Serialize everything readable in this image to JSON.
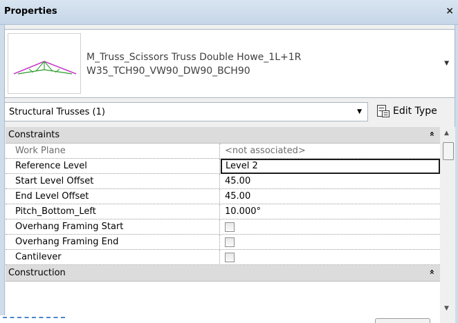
{
  "panel": {
    "title": "Properties",
    "close_glyph": "×"
  },
  "type_selector": {
    "name_line1": "M_Truss_Scissors Truss Double Howe_1L+1R",
    "name_line2": "W35_TCH90_VW90_DW90_BCH90",
    "thumbnail_icon": "truss-thumbnail-icon",
    "dropdown_glyph": "▼"
  },
  "instance_filter": {
    "label": "Structural Trusses (1)",
    "dropdown_glyph": "▼"
  },
  "edit_type": {
    "label": "Edit Type",
    "icon": "edit-type-icon"
  },
  "groups": {
    "constraints": {
      "label": "Constraints",
      "toggle_glyph": "»"
    },
    "construction": {
      "label": "Construction",
      "toggle_glyph": "»"
    }
  },
  "rows": [
    {
      "name": "Work Plane",
      "value": "<not associated>"
    },
    {
      "name": "Reference Level",
      "value": "Level 2"
    },
    {
      "name": "Start Level Offset",
      "value": "45.00"
    },
    {
      "name": "End Level Offset",
      "value": "45.00"
    },
    {
      "name": "Pitch_Bottom_Left",
      "value": "10.000°"
    },
    {
      "name": "Overhang Framing Start",
      "checked": false
    },
    {
      "name": "Overhang Framing End",
      "checked": false
    },
    {
      "name": "Cantilever",
      "checked": false
    }
  ],
  "scrollbar": {
    "up_glyph": "▲",
    "down_glyph": "▼"
  },
  "colors": {
    "title_bar": "#c6d6e8",
    "group_header": "#dcdcdc",
    "truss_magenta": "#c83cc8",
    "truss_green": "#2a9a2a"
  }
}
